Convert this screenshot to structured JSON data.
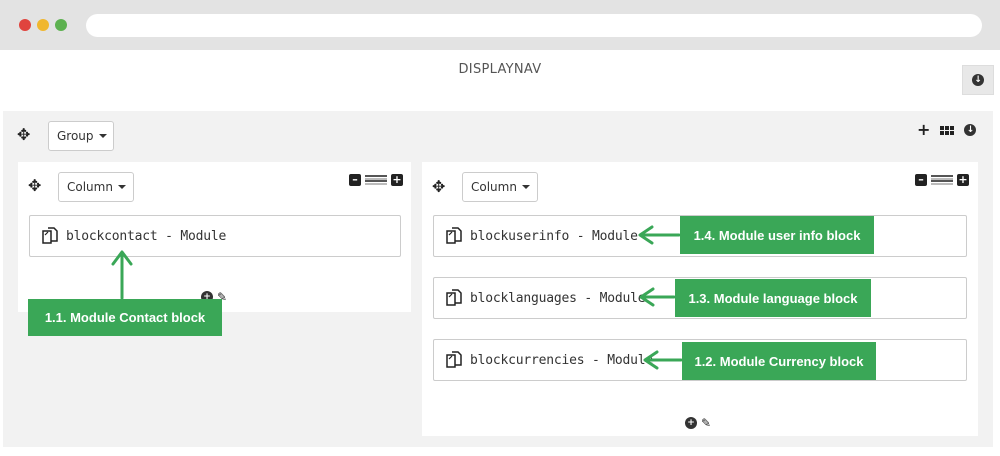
{
  "browser": {
    "dots": [
      "#e0443e",
      "#f0b72f",
      "#5db150"
    ]
  },
  "hook": {
    "title": "DISPLAYNAV"
  },
  "group": {
    "dropdown_label": "Group"
  },
  "columns": [
    {
      "dropdown_label": "Column",
      "modules": [
        {
          "label": "blockcontact - Module"
        }
      ]
    },
    {
      "dropdown_label": "Column",
      "modules": [
        {
          "label": "blockuserinfo - Module"
        },
        {
          "label": "blocklanguages - Module"
        },
        {
          "label": "blockcurrencies - Module"
        }
      ]
    }
  ],
  "callouts": {
    "contact": "1.1. Module Contact block",
    "userinfo": "1.4. Module user info block",
    "language": "1.3. Module language block",
    "currency": "1.2. Module Currency block"
  },
  "colors": {
    "accent": "#3aa757",
    "panel": "#f2f2f2"
  }
}
